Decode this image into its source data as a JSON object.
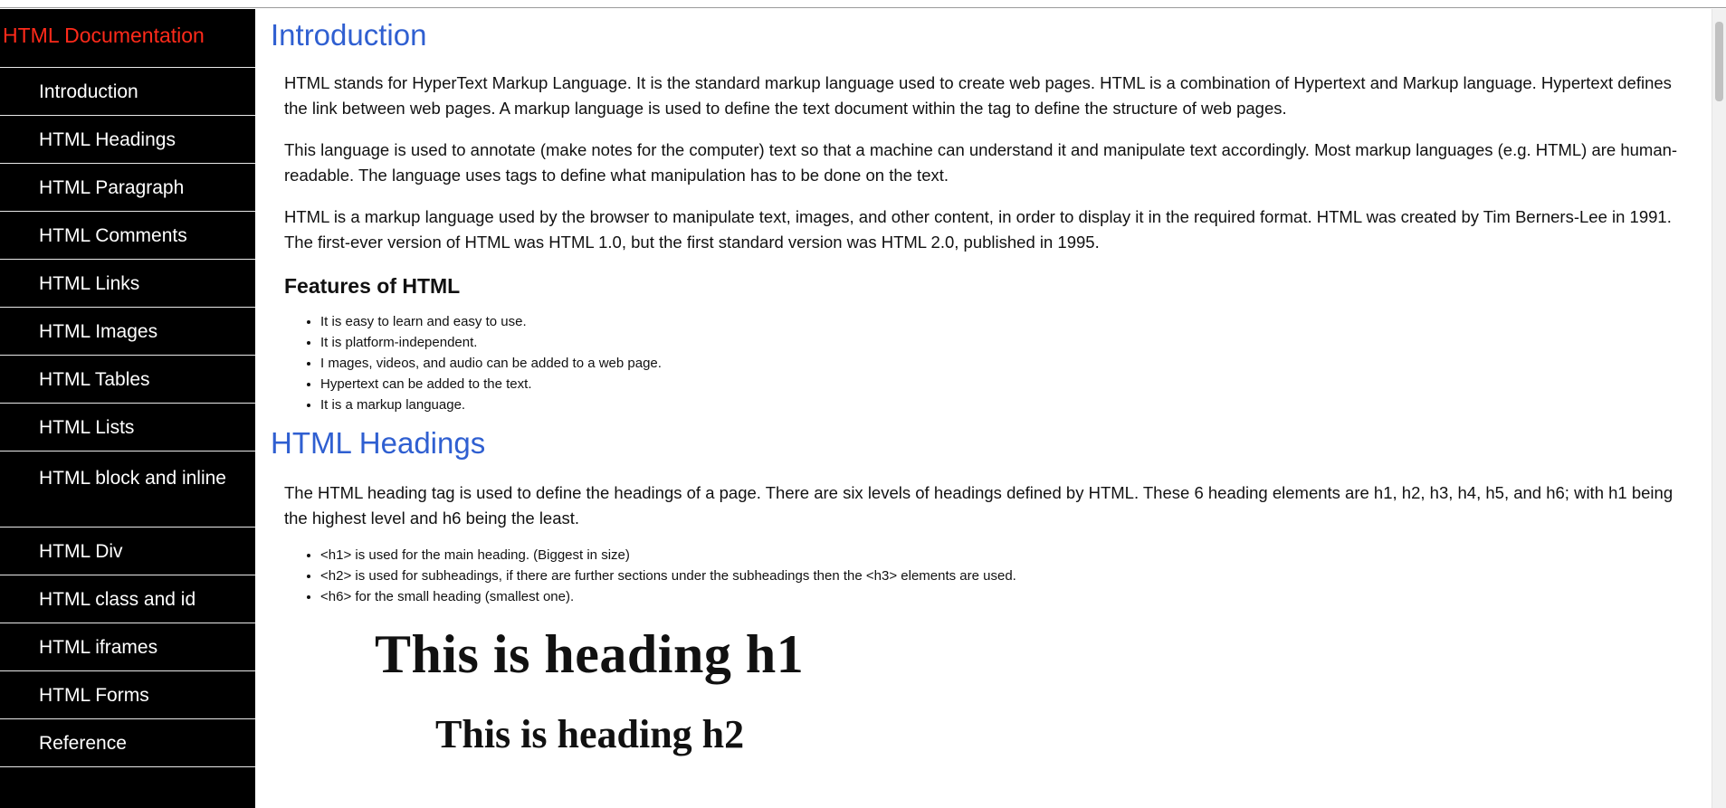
{
  "sidebar": {
    "title": "HTML Documentation",
    "items": [
      {
        "label": "Introduction"
      },
      {
        "label": "HTML Headings"
      },
      {
        "label": "HTML Paragraph"
      },
      {
        "label": "HTML Comments"
      },
      {
        "label": "HTML Links"
      },
      {
        "label": "HTML Images"
      },
      {
        "label": "HTML Tables"
      },
      {
        "label": "HTML Lists"
      },
      {
        "label": "HTML block and inline"
      },
      {
        "label": "HTML Div"
      },
      {
        "label": "HTML class and id"
      },
      {
        "label": "HTML iframes"
      },
      {
        "label": "HTML Forms"
      },
      {
        "label": "Reference"
      }
    ]
  },
  "content": {
    "intro": {
      "title": "Introduction",
      "paragraphs": [
        "HTML stands for HyperText Markup Language. It is the standard markup language used to create web pages. HTML is a combination of Hypertext and Markup language. Hypertext defines the link between web pages. A markup language is used to define the text document within the tag to define the structure of web pages.",
        "This language is used to annotate (make notes for the computer) text so that a machine can understand it and manipulate text accordingly. Most markup languages (e.g. HTML) are human-readable. The language uses tags to define what manipulation has to be done on the text.",
        "HTML is a markup language used by the browser to manipulate text, images, and other content, in order to display it in the required format. HTML was created by Tim Berners-Lee in 1991. The first-ever version of HTML was HTML 1.0, but the first standard version was HTML 2.0, published in 1995."
      ],
      "features_heading": "Features of HTML",
      "features": [
        "It is easy to learn and easy to use.",
        "It is platform-independent.",
        "I mages, videos, and audio can be added to a web page.",
        "Hypertext can be added to the text.",
        "It is a markup language."
      ]
    },
    "headings": {
      "title": "HTML Headings",
      "paragraph": "The HTML heading tag is used to define the headings of a page. There are six levels of headings defined by HTML. These 6 heading elements are h1, h2, h3, h4, h5, and h6; with h1 being the highest level and h6 being the least.",
      "items": [
        "<h1> is used for the main heading. (Biggest in size)",
        "<h2> is used for subheadings, if there are further sections under the subheadings then the <h3> elements are used.",
        "<h6> for the small heading (smallest one)."
      ],
      "example_h1": "This is heading h1",
      "example_h2": "This is heading h2"
    }
  },
  "colors": {
    "sidebar_bg": "#000000",
    "sidebar_title": "#ff2a1a",
    "section_title": "#2f5fd1"
  }
}
